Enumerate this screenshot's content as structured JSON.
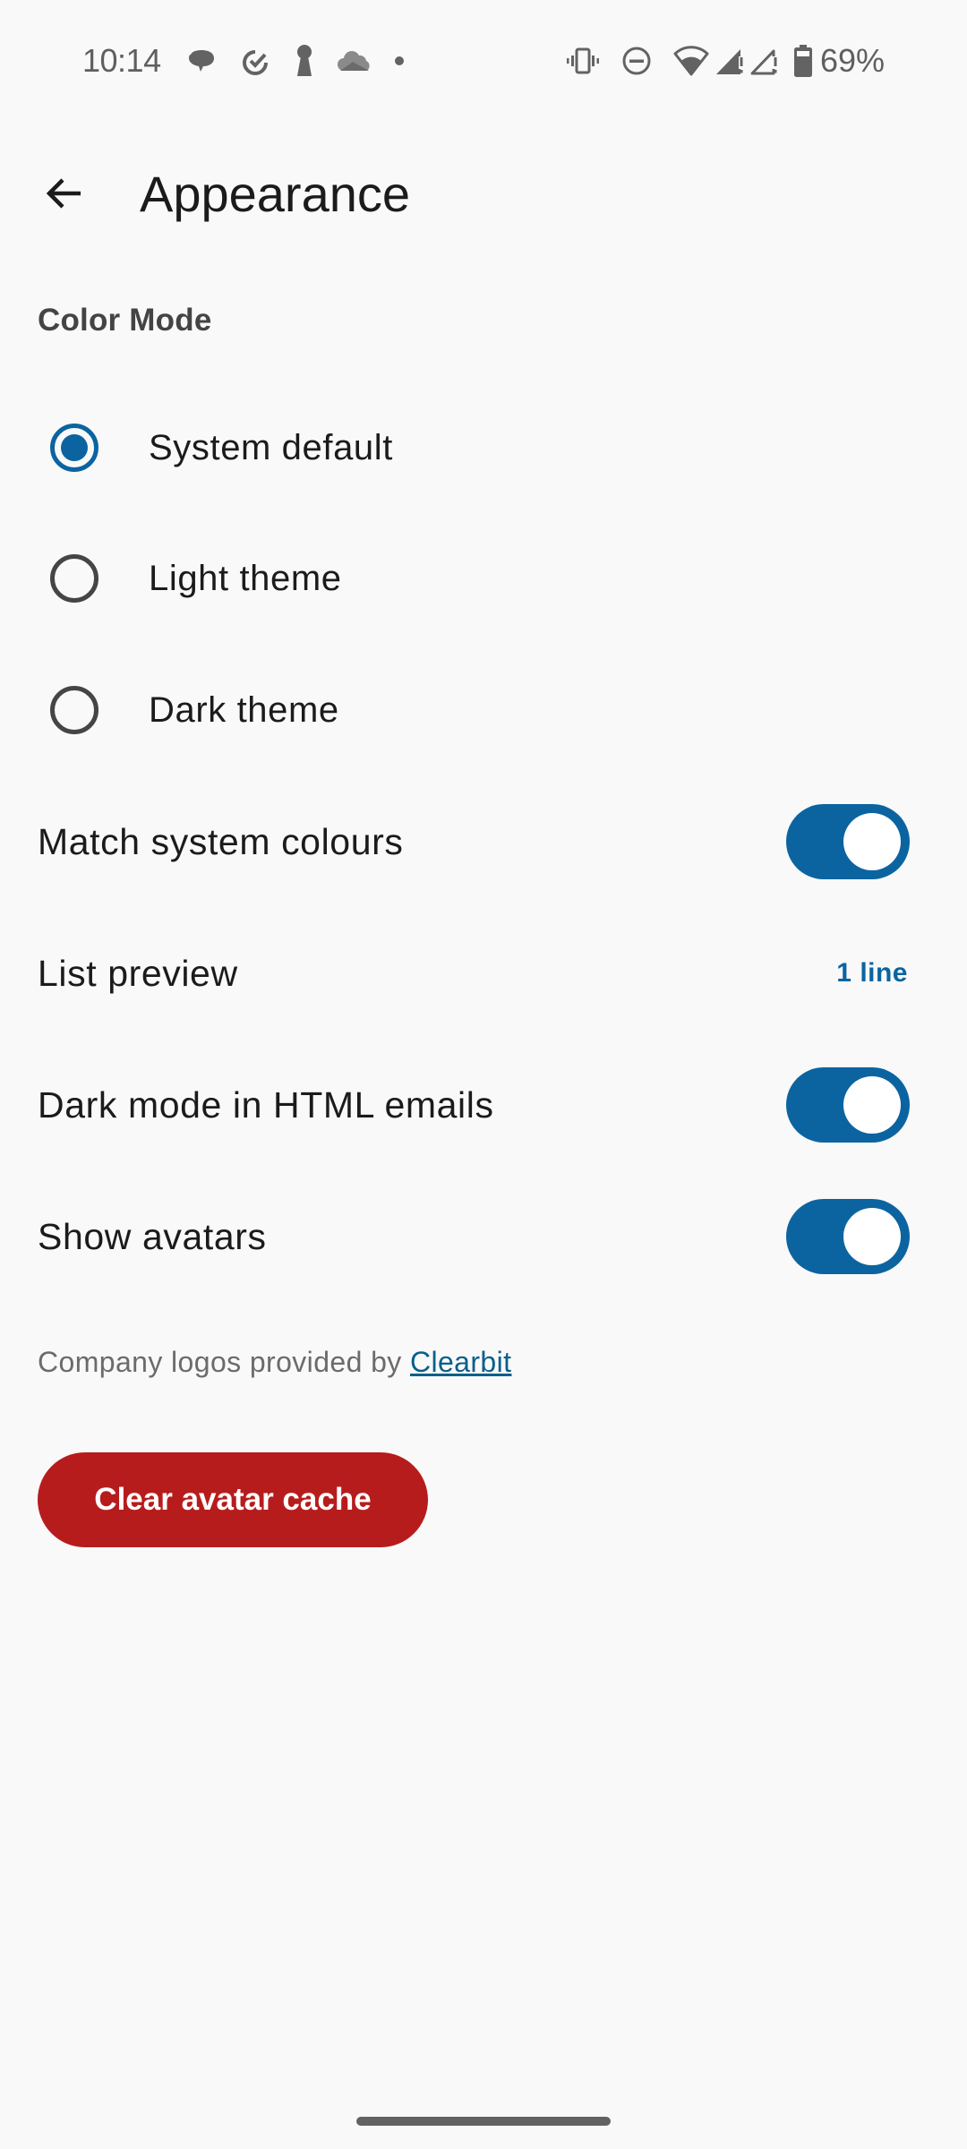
{
  "status_bar": {
    "time": "10:14",
    "notification_icons": [
      "chat-bubble-icon",
      "check-circle-icon",
      "keyhole-icon",
      "cloud-icon",
      "more-dot-icon"
    ],
    "system_icons": [
      "vibrate-icon",
      "do-not-disturb-icon",
      "wifi-icon",
      "signal-alert-icon",
      "signal-alert-empty-icon",
      "battery-icon"
    ],
    "battery": "69%"
  },
  "app_bar": {
    "back_icon": "arrow-back-icon",
    "title": "Appearance"
  },
  "color_mode": {
    "header": "Color Mode",
    "options": [
      {
        "label": "System default",
        "selected": true
      },
      {
        "label": "Light theme",
        "selected": false
      },
      {
        "label": "Dark theme",
        "selected": false
      }
    ]
  },
  "settings": {
    "match_system_colours": {
      "label": "Match system colours",
      "enabled": true
    },
    "list_preview": {
      "label": "List preview",
      "value": "1 line"
    },
    "dark_mode_html": {
      "label": "Dark mode in HTML emails",
      "enabled": true
    },
    "show_avatars": {
      "label": "Show avatars",
      "enabled": true
    }
  },
  "footnote": {
    "text": "Company logos provided by ",
    "link": "Clearbit"
  },
  "clear_cache_button": "Clear avatar cache",
  "colors": {
    "accent": "#0b64a0",
    "danger": "#b71c1c",
    "background": "#f9f9f9"
  }
}
